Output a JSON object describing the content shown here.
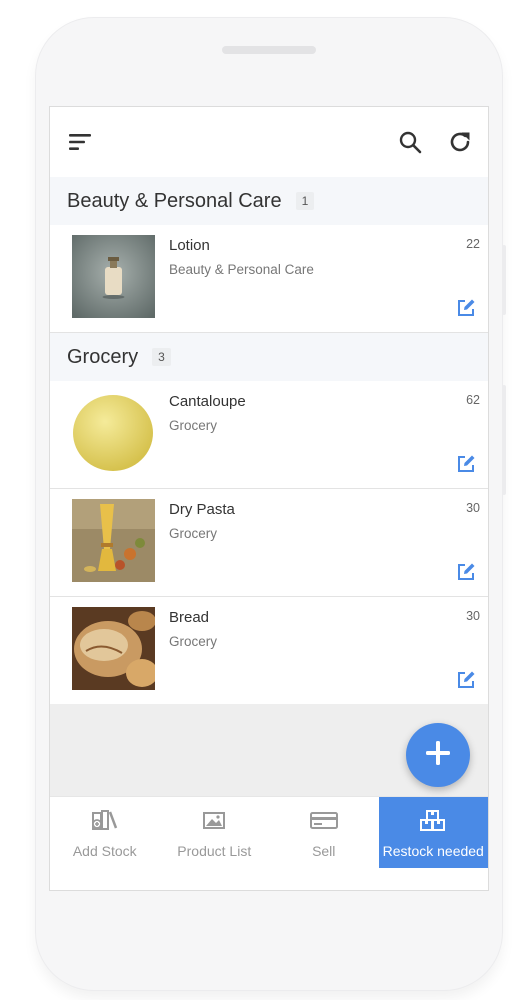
{
  "toolbar": {
    "menu_icon": "menu-icon",
    "search_icon": "search-icon",
    "refresh_icon": "refresh-icon"
  },
  "sections": [
    {
      "title": "Beauty & Personal Care",
      "count": "1",
      "items": [
        {
          "name": "Lotion",
          "category": "Beauty & Personal Care",
          "qty": "22"
        }
      ]
    },
    {
      "title": "Grocery",
      "count": "3",
      "items": [
        {
          "name": "Cantaloupe",
          "category": "Grocery",
          "qty": "62"
        },
        {
          "name": "Dry Pasta",
          "category": "Grocery",
          "qty": "30"
        },
        {
          "name": "Bread",
          "category": "Grocery",
          "qty": "30"
        }
      ]
    }
  ],
  "fab": {
    "icon": "plus-icon"
  },
  "bottom_nav": [
    {
      "label": "Add Stock",
      "icon": "add-stock-icon"
    },
    {
      "label": "Product List",
      "icon": "image-icon"
    },
    {
      "label": "Sell",
      "icon": "card-icon"
    },
    {
      "label": "Restock needed",
      "icon": "boxes-icon",
      "active": true
    }
  ],
  "colors": {
    "accent": "#4a8ae6",
    "section_bg": "#f5f7fa",
    "text": "#333333",
    "muted": "#777777"
  }
}
